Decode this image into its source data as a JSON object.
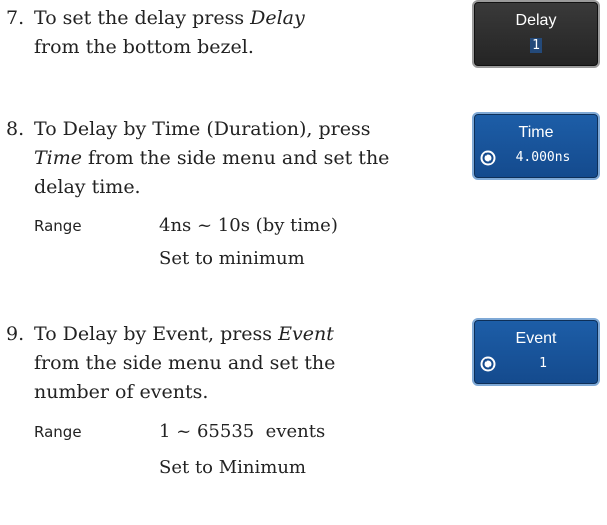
{
  "steps": [
    {
      "number": "7.",
      "text_before": "To set the delay press ",
      "emph": "Delay",
      "text_after": " from the bottom bezel."
    },
    {
      "number": "8.",
      "text_before": "To Delay by Time (Duration), press ",
      "emph": "Time",
      "text_after": " from the side menu and set the delay time.",
      "param_label": "Range",
      "param_value": "4ns ~ 10s (by time)",
      "param_note": "Set to minimum"
    },
    {
      "number": "9.",
      "text_before": "To Delay by Event, press ",
      "emph": "Event",
      "text_after": " from the side menu and set the number of events.",
      "param_label": "Range",
      "param_value": "1 ~ 65535  events",
      "param_note": "Set to Minimum"
    }
  ],
  "keys": {
    "delay": {
      "title": "Delay",
      "value": "1",
      "style": "dark-gray"
    },
    "time": {
      "title": "Time",
      "value": "4.000ns",
      "style": "blue",
      "icon": "rotary-knob-icon"
    },
    "event": {
      "title": "Event",
      "value": "1",
      "style": "blue",
      "icon": "rotary-knob-icon"
    }
  },
  "colors": {
    "key_blue": "#1d5ea8",
    "key_dark": "#2e2e2e",
    "text": "#222222"
  }
}
